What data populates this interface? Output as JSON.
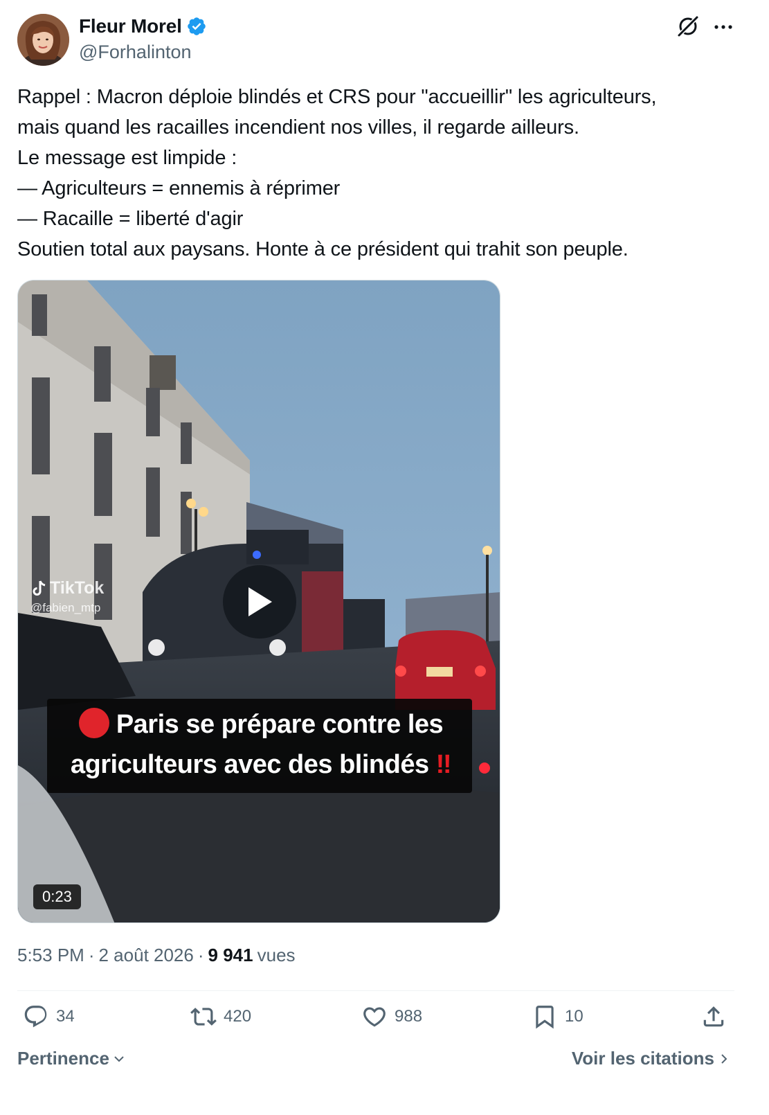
{
  "author": {
    "display_name": "Fleur Morel",
    "handle": "@Forhalinton",
    "verified": true,
    "verified_color": "#1d9bf0"
  },
  "header_icons": {
    "grok": "grok-icon",
    "more": "more-icon"
  },
  "tweet": {
    "lines": [
      "Rappel : Macron déploie blindés et CRS pour \"accueillir\" les agriculteurs,",
      "mais quand les racailles incendient nos villes, il regarde ailleurs.",
      "Le message est limpide :",
      "— Agriculteurs = ennemis à réprimer",
      "— Racaille = liberté d'agir",
      "Soutien total aux paysans. Honte à ce président qui trahit son peuple."
    ]
  },
  "media": {
    "tiktok_label": "TikTok",
    "tiktok_user": "@fabien_mtp",
    "caption_line1": "Paris se prépare contre les",
    "caption_line2": "agriculteurs avec des blindés",
    "caption_emphasis": "‼",
    "duration": "0:23"
  },
  "meta": {
    "time": "5:53 PM",
    "separator": "·",
    "date": "2 août 2026",
    "views_count": "9 941",
    "views_label": "vues"
  },
  "actions": {
    "replies": "34",
    "reposts": "420",
    "likes": "988",
    "bookmarks": "10"
  },
  "footer": {
    "sort_label": "Pertinence",
    "quotes_label": "Voir les citations"
  },
  "colors": {
    "text_primary": "#0f1419",
    "text_secondary": "#536471",
    "divider": "#eff3f4"
  }
}
